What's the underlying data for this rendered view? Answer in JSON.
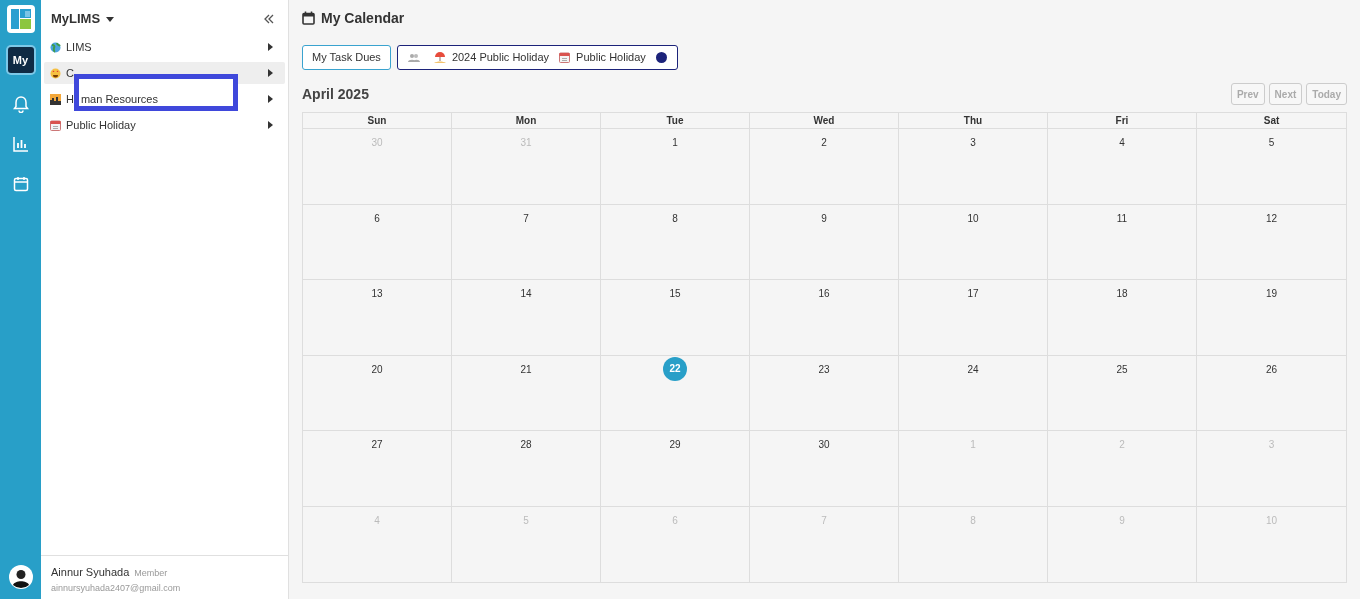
{
  "rail": {
    "my_tile": "My",
    "items": [
      {
        "kind": "bell"
      },
      {
        "kind": "chart"
      },
      {
        "kind": "calendar"
      }
    ]
  },
  "sidebar": {
    "title": "MyLIMS",
    "items": [
      {
        "label": "LIMS",
        "kind": "globe",
        "selected": false
      },
      {
        "label_parts": [
          "C"
        ],
        "kind": "smiley",
        "selected": true
      },
      {
        "label_parts": [
          "H",
          "man Resources"
        ],
        "kind": "city",
        "selected": false
      },
      {
        "label": "Public Holiday",
        "kind": "calendar",
        "selected": false
      }
    ],
    "user": {
      "name": "Ainnur Syuhada",
      "role": "Member",
      "email": "ainnursyuhada2407@gmail.com"
    }
  },
  "page_title": "My Calendar",
  "filters": {
    "button": "My Task Dues",
    "legend": [
      {
        "kind": "people"
      },
      {
        "kind": "beach",
        "label": "2024 Public Holiday"
      },
      {
        "kind": "calendar",
        "label": "Public Holiday"
      },
      {
        "kind": "dot",
        "color": "#1c237a"
      }
    ]
  },
  "calendar": {
    "title": "April 2025",
    "nav": [
      {
        "label": "Prev",
        "disabled": true
      },
      {
        "label": "Next",
        "disabled": true
      },
      {
        "label": "Today",
        "disabled": true
      }
    ],
    "weekdays": [
      "Sun",
      "Mon",
      "Tue",
      "Wed",
      "Thu",
      "Fri",
      "Sat"
    ],
    "weeks": [
      [
        {
          "day": "30",
          "outside": true
        },
        {
          "day": "31",
          "outside": true
        },
        {
          "day": "1",
          "outside": false
        },
        {
          "day": "2",
          "outside": false
        },
        {
          "day": "3",
          "outside": false
        },
        {
          "day": "4",
          "outside": false
        },
        {
          "day": "5",
          "outside": false
        }
      ],
      [
        {
          "day": "6",
          "outside": false
        },
        {
          "day": "7",
          "outside": false
        },
        {
          "day": "8",
          "outside": false
        },
        {
          "day": "9",
          "outside": false
        },
        {
          "day": "10",
          "outside": false
        },
        {
          "day": "11",
          "outside": false
        },
        {
          "day": "12",
          "outside": false
        }
      ],
      [
        {
          "day": "13",
          "outside": false
        },
        {
          "day": "14",
          "outside": false
        },
        {
          "day": "15",
          "outside": false
        },
        {
          "day": "16",
          "outside": false
        },
        {
          "day": "17",
          "outside": false
        },
        {
          "day": "18",
          "outside": false
        },
        {
          "day": "19",
          "outside": false
        }
      ],
      [
        {
          "day": "20",
          "outside": false
        },
        {
          "day": "21",
          "outside": false
        },
        {
          "day": "22",
          "outside": false,
          "today": true
        },
        {
          "day": "23",
          "outside": false
        },
        {
          "day": "24",
          "outside": false
        },
        {
          "day": "25",
          "outside": false
        },
        {
          "day": "26",
          "outside": false
        }
      ],
      [
        {
          "day": "27",
          "outside": false
        },
        {
          "day": "28",
          "outside": false
        },
        {
          "day": "29",
          "outside": false
        },
        {
          "day": "30",
          "outside": false
        },
        {
          "day": "1",
          "outside": true
        },
        {
          "day": "2",
          "outside": true
        },
        {
          "day": "3",
          "outside": true
        }
      ],
      [
        {
          "day": "4",
          "outside": true
        },
        {
          "day": "5",
          "outside": true
        },
        {
          "day": "6",
          "outside": true
        },
        {
          "day": "7",
          "outside": true
        },
        {
          "day": "8",
          "outside": true
        },
        {
          "day": "9",
          "outside": true
        },
        {
          "day": "10",
          "outside": true
        }
      ]
    ]
  },
  "annotation": {
    "kind": "box"
  }
}
